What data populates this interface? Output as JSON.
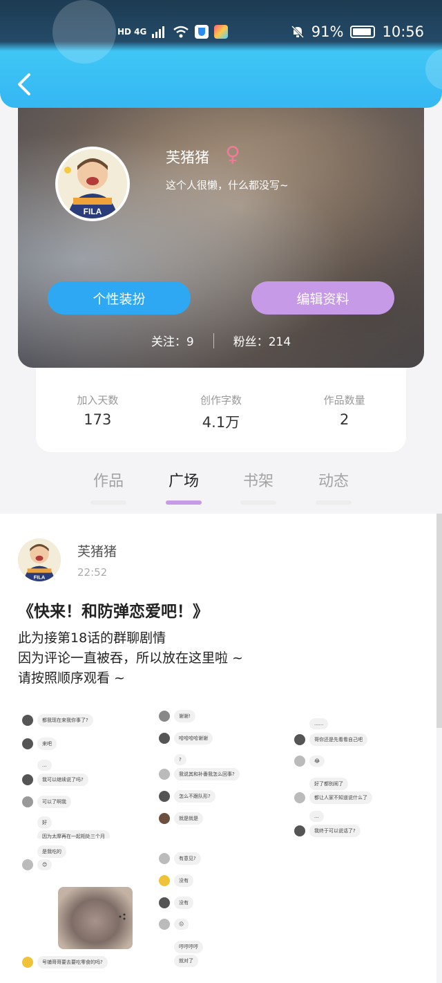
{
  "status_bar": {
    "network": "HD 4G",
    "battery": "91%",
    "time": "10:56"
  },
  "profile": {
    "nickname": "芙猪猪",
    "gender_symbol": "♀",
    "bio": "这个人很懒，什么都没写~",
    "dress_button": "个性装扮",
    "edit_button": "编辑资料",
    "following_label": "关注：",
    "following_count": "9",
    "fans_label": "粉丝：",
    "fans_count": "214"
  },
  "stats": [
    {
      "label": "加入天数",
      "value": "173"
    },
    {
      "label": "创作字数",
      "value": "4.1万"
    },
    {
      "label": "作品数量",
      "value": "2"
    }
  ],
  "tabs": [
    {
      "label": "作品",
      "active": false
    },
    {
      "label": "广场",
      "active": true
    },
    {
      "label": "书架",
      "active": false
    },
    {
      "label": "动态",
      "active": false
    }
  ],
  "post": {
    "author": "芙猪猪",
    "time": "22:52",
    "title": "《快来！和防弹恋爱吧！》",
    "lines": [
      "此为接第18话的群聊剧情",
      "因为评论一直被吞，所以放在这里啦 ~",
      "请按照顺序观看 ~"
    ]
  },
  "chat_images": {
    "img1": [
      "都我现在来我你事了?",
      "来吧",
      "...",
      "我可以继续说了吗?",
      "可以了啊我",
      "好",
      "因为太摩再在一起相处三个月"
    ],
    "img2": [
      "谢谢!",
      "哈哈哈哈谢谢",
      "?",
      "我说其和补番我怎么回事?",
      "怎么不跟队形?",
      "就是就是"
    ],
    "img3": [
      "......",
      "哥你还是先看看自己吧",
      "😂",
      "好了都别闹了",
      "都让人家不知道说什么了",
      "...",
      "我终于可以说话了?"
    ],
    "img4": [
      "是我吃的",
      "😊",
      "号铺哥哥要去要吃零食的吗?"
    ],
    "img5": [
      "有意见?",
      "没有",
      "没有",
      "😐",
      "哼哼哼哼",
      "就对了"
    ]
  },
  "colors": {
    "header_blue": "#35b7f3",
    "button_blue": "#2ea8f2",
    "button_purple": "#c69ae6",
    "gender_pink": "#f07a9a",
    "tab_indicator": "#c69ae6"
  }
}
